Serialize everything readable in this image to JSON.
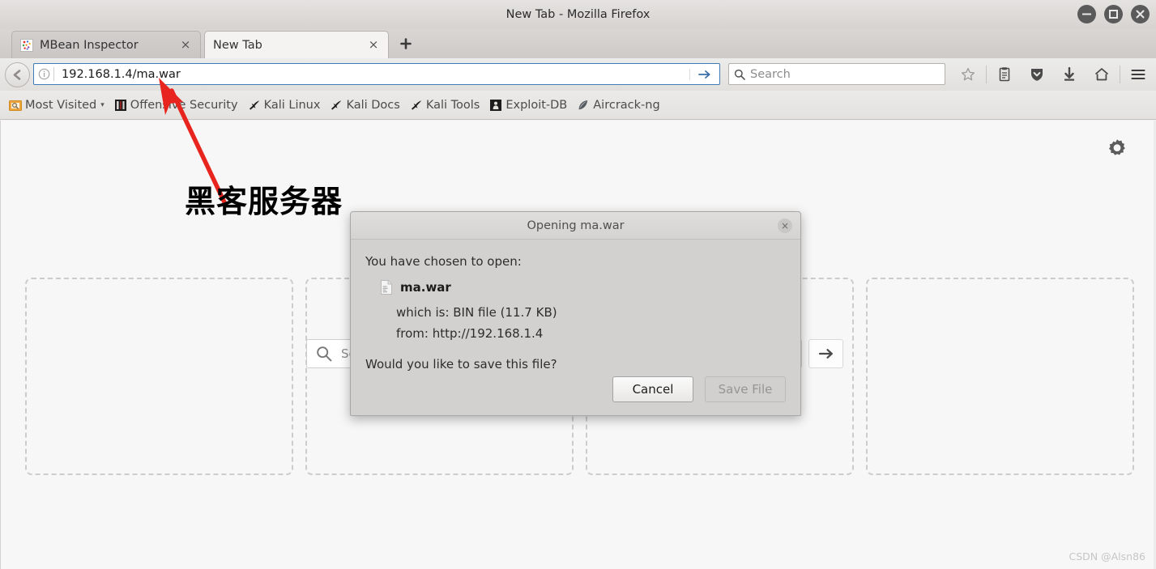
{
  "window": {
    "title": "New Tab - Mozilla Firefox",
    "controls": [
      {
        "name": "minimize-button",
        "glyph": "–"
      },
      {
        "name": "maximize-button",
        "glyph": "□"
      },
      {
        "name": "close-button",
        "glyph": "×"
      }
    ]
  },
  "tabs": {
    "items": [
      {
        "label": "MBean Inspector",
        "active": false,
        "close_label": "×",
        "favicon": "java-beans-icon"
      },
      {
        "label": "New Tab",
        "active": true,
        "close_label": "×",
        "favicon": "blank-icon"
      }
    ],
    "new_tab_label": "+"
  },
  "toolbar": {
    "back_label": "←",
    "identity_icon": "info-circle-icon",
    "url_value": "192.168.1.4/ma.war",
    "go_label": "→",
    "search_placeholder": "Search",
    "icons": [
      {
        "name": "bookmark-star-icon"
      },
      {
        "name": "reader-list-icon"
      },
      {
        "name": "pocket-shield-icon"
      },
      {
        "name": "downloads-arrow-icon"
      },
      {
        "name": "home-icon"
      },
      {
        "name": "hamburger-menu-icon"
      }
    ]
  },
  "bookmarks": {
    "items": [
      {
        "label": "Most Visited",
        "icon": "most-visited-icon",
        "has_caret": true,
        "caret": "▾"
      },
      {
        "label": "Offensive Security",
        "icon": "offensive-security-icon",
        "has_caret": false
      },
      {
        "label": "Kali Linux",
        "icon": "kali-dragon-icon",
        "has_caret": false
      },
      {
        "label": "Kali Docs",
        "icon": "kali-dragon-icon",
        "has_caret": false
      },
      {
        "label": "Kali Tools",
        "icon": "kali-dragon-icon",
        "has_caret": false
      },
      {
        "label": "Exploit-DB",
        "icon": "exploit-db-icon",
        "has_caret": false
      },
      {
        "label": "Aircrack-ng",
        "icon": "aircrack-ng-icon",
        "has_caret": false
      }
    ]
  },
  "newtab": {
    "search_placeholder": "Search",
    "go_label": "→",
    "gear_icon": "gear-icon",
    "tile_count": 4
  },
  "annotation": {
    "text": "黑客服务器",
    "arrow_color": "#e8241e"
  },
  "dialog": {
    "title": "Opening ma.war",
    "close_label": "×",
    "intro": "You have chosen to open:",
    "file_name": "ma.war",
    "which_is": "which is:  BIN file (11.7 KB)",
    "from": "from:  http://192.168.1.4",
    "question": "Would you like to save this file?",
    "cancel_label": "Cancel",
    "save_label": "Save File"
  },
  "watermark": {
    "text": "CSDN @Alsn86"
  }
}
